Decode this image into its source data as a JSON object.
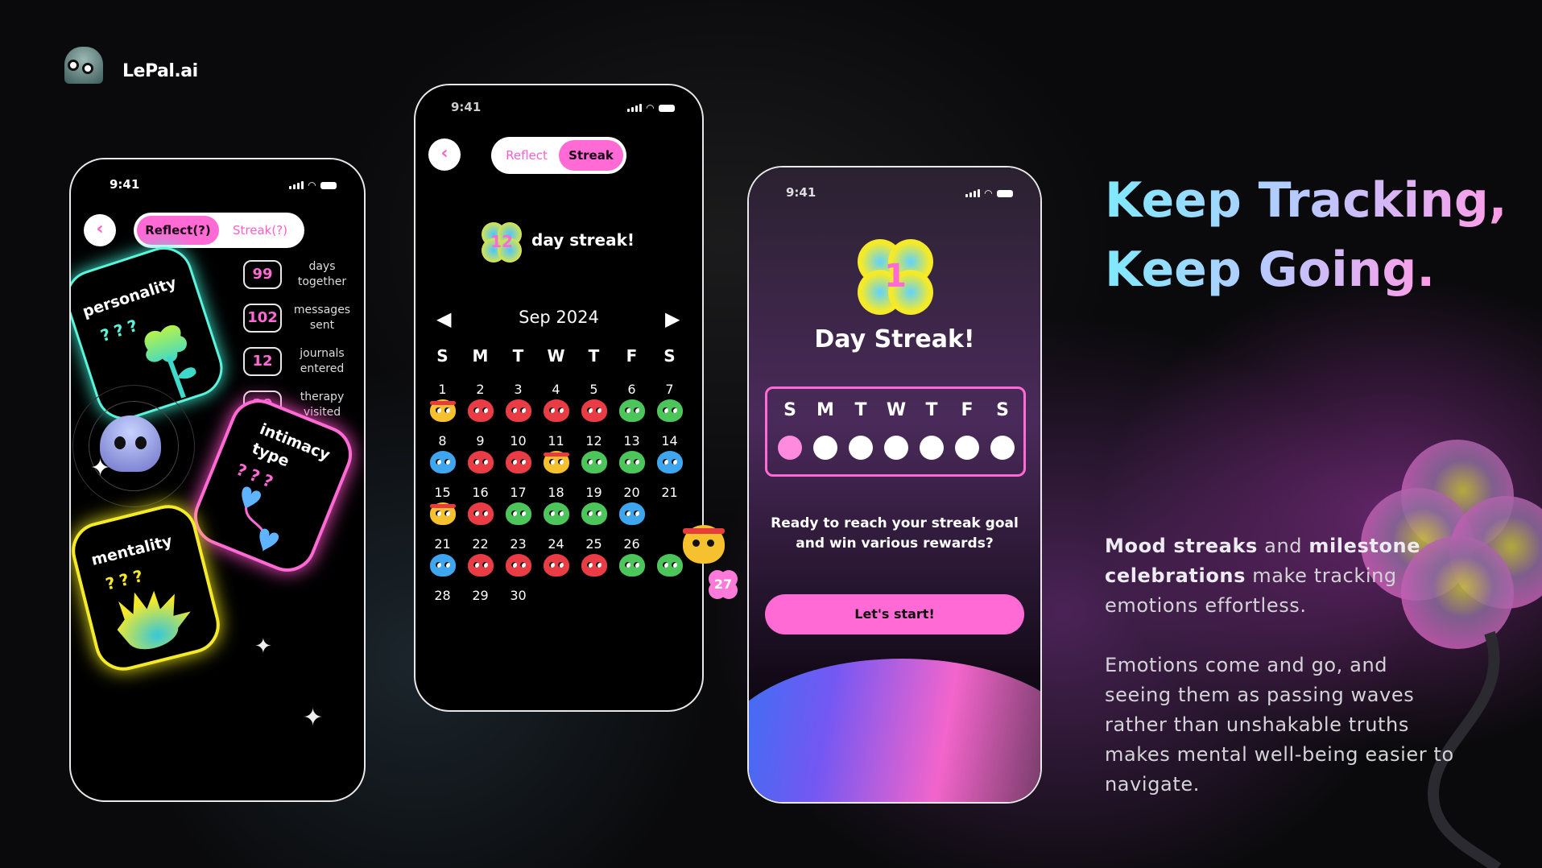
{
  "brand": {
    "name": "LePal.ai"
  },
  "phone1": {
    "time": "9:41",
    "tabs": {
      "reflect": "Reflect(?)",
      "streak": "Streak(?)"
    },
    "stats": [
      {
        "value": "99",
        "label_line1": "days",
        "label_line2": "together"
      },
      {
        "value": "102",
        "label_line1": "messages",
        "label_line2": "sent"
      },
      {
        "value": "12",
        "label_line1": "journals",
        "label_line2": "entered"
      },
      {
        "value": "20",
        "label_line1": "therapy",
        "label_line2": "visited"
      }
    ],
    "cards": {
      "personality": {
        "label": "personality",
        "mystery": "???"
      },
      "intimacy": {
        "label_line1": "intimacy",
        "label_line2": "type",
        "mystery": "???"
      },
      "mentality": {
        "label": "mentality",
        "mystery": "???"
      }
    }
  },
  "phone2": {
    "time": "9:41",
    "tabs": {
      "reflect": "Reflect",
      "streak": "Streak"
    },
    "streak_count": "12",
    "streak_text": "day streak!",
    "month": "Sep 2024",
    "weekdays": [
      "S",
      "M",
      "T",
      "W",
      "T",
      "F",
      "S"
    ],
    "weeks": [
      {
        "days": [
          "1",
          "2",
          "3",
          "4",
          "5",
          "6",
          "7"
        ],
        "moods": [
          "yellow",
          "red",
          "red",
          "red",
          "red",
          "green",
          "green"
        ]
      },
      {
        "days": [
          "8",
          "9",
          "10",
          "11",
          "12",
          "13",
          "14"
        ],
        "moods": [
          "blue",
          "red",
          "red",
          "yellow",
          "green",
          "green",
          "blue"
        ]
      },
      {
        "days": [
          "15",
          "16",
          "17",
          "18",
          "19",
          "20",
          "21"
        ],
        "moods": [
          "yellow",
          "red",
          "green",
          "green",
          "green",
          "blue",
          ""
        ]
      },
      {
        "days": [
          "21",
          "22",
          "23",
          "24",
          "25",
          "26",
          ""
        ],
        "moods": [
          "blue",
          "red",
          "red",
          "red",
          "red",
          "green",
          "green"
        ]
      },
      {
        "days": [
          "28",
          "29",
          "30",
          "",
          "",
          "",
          ""
        ],
        "moods": [
          "",
          "",
          "",
          "",
          "",
          "",
          ""
        ]
      }
    ],
    "today_badge": "27"
  },
  "phone3": {
    "time": "9:41",
    "streak_count": "1",
    "title": "Day Streak!",
    "weekdays": [
      "S",
      "M",
      "T",
      "W",
      "T",
      "F",
      "S"
    ],
    "prompt_line1": "Ready to reach your streak goal",
    "prompt_line2": "and win various rewards?",
    "cta": "Let's start!"
  },
  "hero": {
    "line1": "Keep Tracking,",
    "line2": "Keep Going."
  },
  "copy": {
    "p1_bold1": "Mood streaks",
    "p1_mid": " and ",
    "p1_bold2": "milestone celebrations",
    "p1_rest": " make tracking emotions effortless.",
    "p2": "Emotions come and go, and seeing them as passing waves rather than unshakable truths makes mental well-being easier to navigate."
  },
  "colors": {
    "accent_pink": "#ff6ad5",
    "teal": "#52f0d6",
    "yellow": "#f4ea2a"
  }
}
